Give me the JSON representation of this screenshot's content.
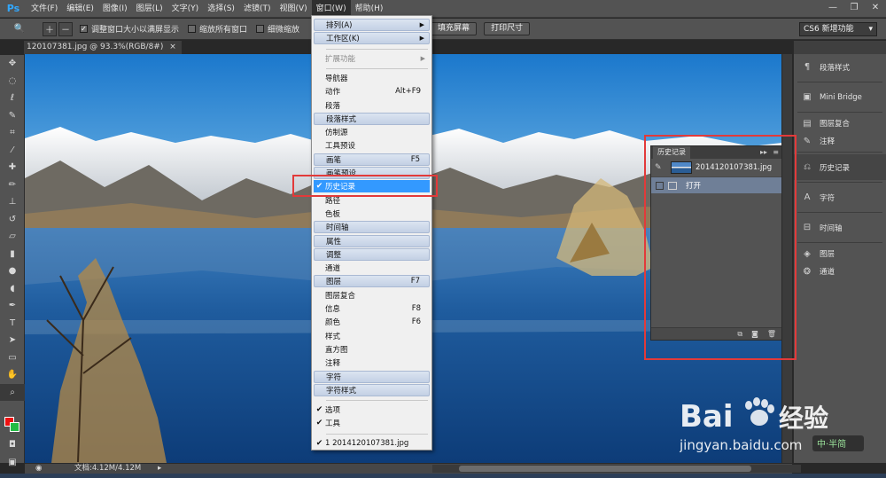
{
  "app": {
    "logo": "Ps",
    "brand_color": "#31a8ff"
  },
  "menubar": {
    "items": [
      "文件(F)",
      "编辑(E)",
      "图像(I)",
      "图层(L)",
      "文字(Y)",
      "选择(S)",
      "滤镜(T)",
      "视图(V)",
      "窗口(W)",
      "帮助(H)"
    ],
    "active": "窗口(W)"
  },
  "window_controls": [
    "—",
    "❐",
    "✕"
  ],
  "options_bar": {
    "resize_windows_label": "调整窗口大小以满屏显示",
    "resize_windows_checked": true,
    "zoom_all_label": "缩放所有窗口",
    "scrubby_zoom_label": "细微缩放",
    "fill_screen_label": "填充屏幕",
    "print_size_label": "打印尺寸",
    "workspace_label": "CS6 新增功能"
  },
  "document_tab": {
    "title": "120107381.jpg @ 93.3%(RGB/8#)",
    "close": "×"
  },
  "window_menu": {
    "items": [
      {
        "label": "排列(A)",
        "arrow": "▶",
        "style": "band"
      },
      {
        "label": "工作区(K)",
        "arrow": "▶",
        "style": "band"
      },
      {
        "separator": true
      },
      {
        "label": "扩展功能",
        "arrow": "▶",
        "style": "disabled"
      },
      {
        "separator": true
      },
      {
        "label": "导航器"
      },
      {
        "label": "动作",
        "shortcut": "Alt+F9"
      },
      {
        "label": "段落"
      },
      {
        "label": "段落样式",
        "style": "band"
      },
      {
        "label": "仿制源"
      },
      {
        "label": "工具预设"
      },
      {
        "label": "画笔",
        "shortcut": "F5",
        "style": "band"
      },
      {
        "label": "画笔预设",
        "style": "band"
      },
      {
        "label": "历史记录",
        "checked": true,
        "style": "hilite"
      },
      {
        "label": "路径"
      },
      {
        "label": "色板"
      },
      {
        "label": "时间轴",
        "style": "band"
      },
      {
        "label": "属性",
        "style": "band"
      },
      {
        "label": "调整",
        "style": "band"
      },
      {
        "label": "通道"
      },
      {
        "label": "图层",
        "shortcut": "F7",
        "style": "band"
      },
      {
        "label": "图层复合"
      },
      {
        "label": "信息",
        "shortcut": "F8"
      },
      {
        "label": "颜色",
        "shortcut": "F6"
      },
      {
        "label": "样式"
      },
      {
        "label": "直方图"
      },
      {
        "label": "注释"
      },
      {
        "label": "字符",
        "style": "band"
      },
      {
        "label": "字符样式",
        "style": "band"
      },
      {
        "separator": true
      },
      {
        "label": "选项",
        "checked": true
      },
      {
        "label": "工具",
        "checked": true
      },
      {
        "separator": true
      },
      {
        "label": "1 20141201073​81.jpg",
        "checked": true
      }
    ],
    "highlight_color": "#3399ff"
  },
  "history_panel": {
    "tab_label": "历史记录",
    "collapse_icon": "▸▸",
    "menu_icon": "≡",
    "snapshot_label": "2014120107381.jpg",
    "state_label": "打开",
    "footer_icons": [
      "new-document-from-state",
      "camera",
      "trash"
    ]
  },
  "dock": {
    "items": [
      {
        "icon": "paragraph-styles-icon",
        "glyph": "¶",
        "label": "段落样式"
      },
      {
        "icon": "mini-bridge-icon",
        "glyph": "▣",
        "label": "Mini Bridge"
      },
      {
        "icon": "layer-comps-icon",
        "glyph": "▤",
        "label": "图层复合"
      },
      {
        "icon": "notes-icon",
        "glyph": "✎",
        "label": "注释"
      },
      {
        "icon": "history-icon",
        "glyph": "⎌",
        "label": "历史记录"
      },
      {
        "icon": "character-icon",
        "glyph": "A",
        "label": "字符"
      },
      {
        "icon": "timeline-icon",
        "glyph": "⊟",
        "label": "时间轴"
      },
      {
        "icon": "layers-icon",
        "glyph": "◈",
        "label": "图层"
      },
      {
        "icon": "channels-icon",
        "glyph": "❂",
        "label": "通道"
      }
    ]
  },
  "status_bar": {
    "doc_info": "文档:4.12M/4.12M"
  },
  "colors": {
    "foreground": "#ee1111",
    "background": "#22bb44",
    "annotation": "#e23a3a"
  },
  "watermark": {
    "brand": "Bai",
    "brand_cn": "经验",
    "url": "jingyan.baidu.com",
    "badge": "中·半简"
  }
}
